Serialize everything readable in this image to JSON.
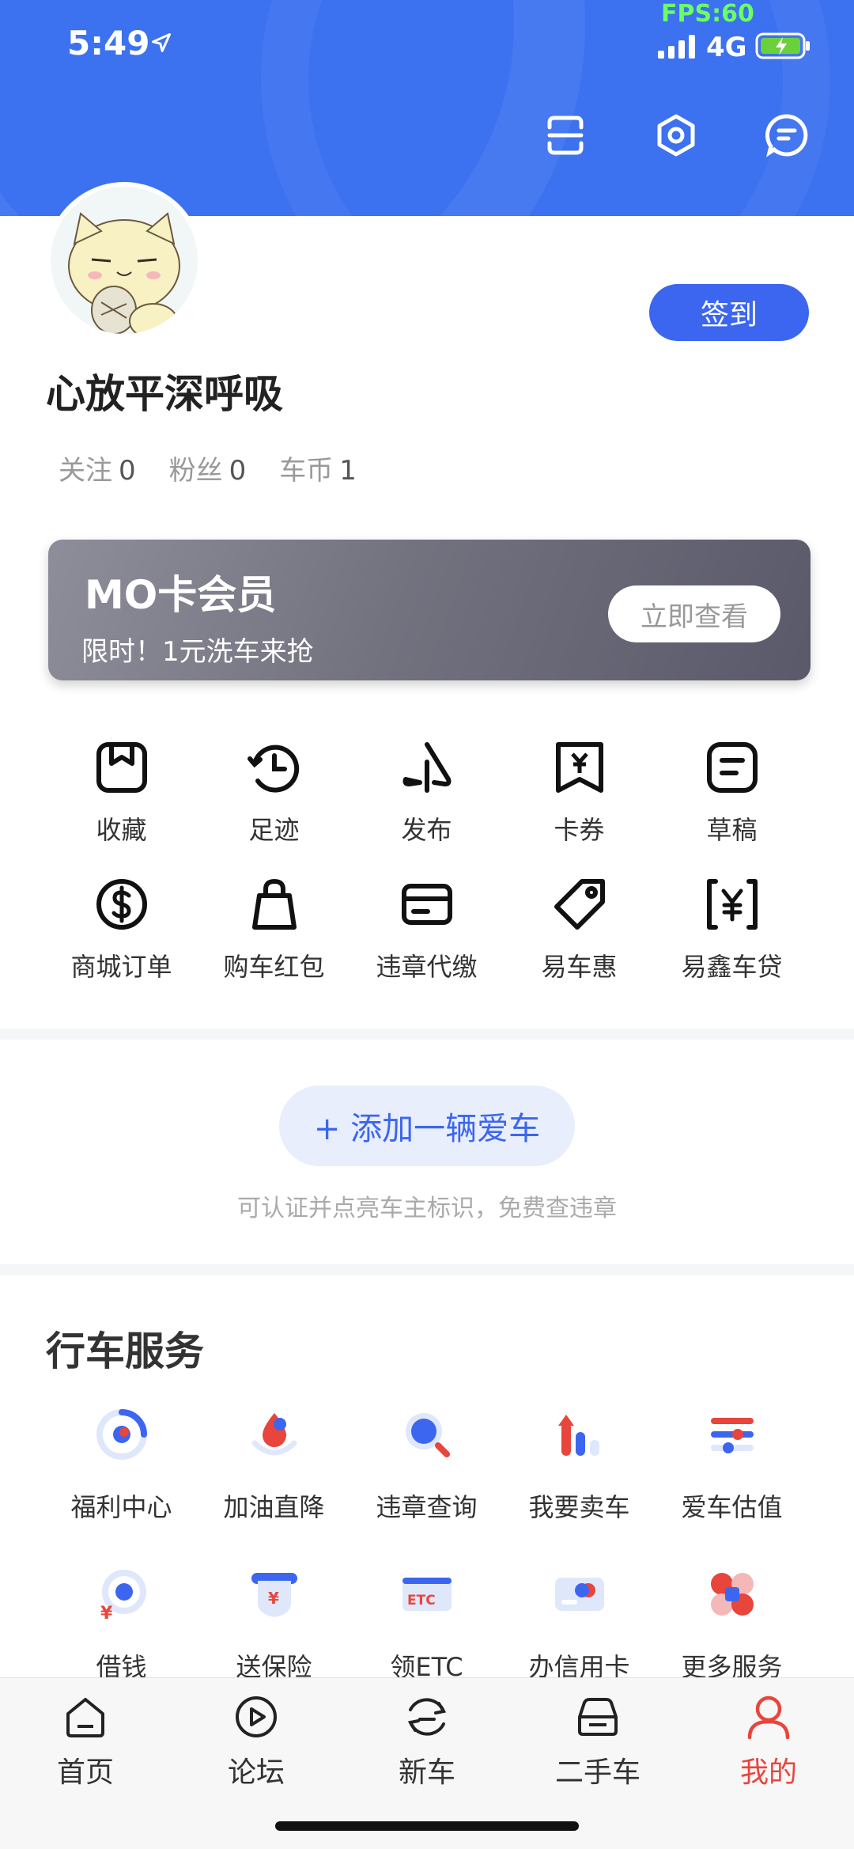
{
  "status_bar": {
    "time": "5:49",
    "fps": "FPS:60",
    "network": "4G"
  },
  "profile": {
    "username": "心放平深呼吸",
    "checkin_label": "签到",
    "stats": [
      {
        "label": "关注",
        "value": "0"
      },
      {
        "label": "粉丝",
        "value": "0"
      },
      {
        "label": "车币",
        "value": "1"
      }
    ]
  },
  "mo_card": {
    "title": "MO卡会员",
    "subtitle": "限时！1元洗车来抢",
    "button": "立即查看"
  },
  "quick_actions": [
    {
      "label": "收藏",
      "icon": "bookmark-icon"
    },
    {
      "label": "足迹",
      "icon": "history-icon"
    },
    {
      "label": "发布",
      "icon": "publish-icon"
    },
    {
      "label": "卡券",
      "icon": "coupon-icon"
    },
    {
      "label": "草稿",
      "icon": "draft-icon"
    },
    {
      "label": "商城订单",
      "icon": "dollar-icon"
    },
    {
      "label": "购车红包",
      "icon": "bag-icon"
    },
    {
      "label": "违章代缴",
      "icon": "card-icon"
    },
    {
      "label": "易车惠",
      "icon": "tag-icon"
    },
    {
      "label": "易鑫车贷",
      "icon": "yen-icon"
    }
  ],
  "add_car": {
    "button": "+ 添加一辆爱车",
    "hint": "可认证并点亮车主标识，免费查违章"
  },
  "services": {
    "title": "行车服务",
    "items": [
      {
        "label": "福利中心",
        "icon": "welfare-icon"
      },
      {
        "label": "加油直降",
        "icon": "fuel-icon"
      },
      {
        "label": "违章查询",
        "icon": "search-icon"
      },
      {
        "label": "我要卖车",
        "icon": "sell-icon"
      },
      {
        "label": "爱车估值",
        "icon": "valuation-icon"
      },
      {
        "label": "借钱",
        "icon": "loan-icon"
      },
      {
        "label": "送保险",
        "icon": "insurance-icon"
      },
      {
        "label": "领ETC",
        "icon": "etc-icon",
        "badge": "ETC"
      },
      {
        "label": "办信用卡",
        "icon": "creditcard-icon"
      },
      {
        "label": "更多服务",
        "icon": "more-icon"
      }
    ]
  },
  "tabbar": [
    {
      "label": "首页",
      "icon": "home-icon"
    },
    {
      "label": "论坛",
      "icon": "forum-icon"
    },
    {
      "label": "新车",
      "icon": "newcar-icon"
    },
    {
      "label": "二手车",
      "icon": "usedcar-icon"
    },
    {
      "label": "我的",
      "icon": "profile-icon",
      "active": true
    }
  ],
  "colors": {
    "brand_blue": "#3c71f0",
    "accent_red": "#e8453c",
    "fps_green": "#6bff63"
  }
}
